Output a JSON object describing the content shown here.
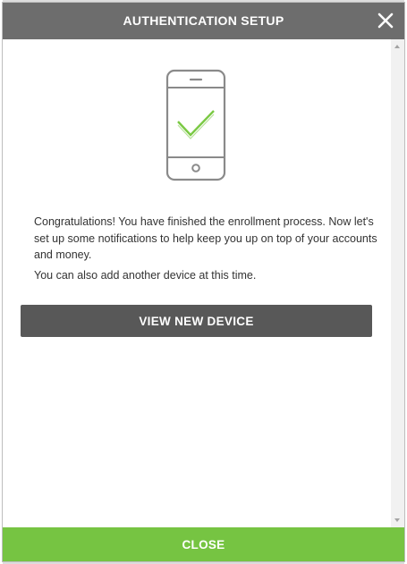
{
  "dialog": {
    "title": "AUTHENTICATION SETUP",
    "close_icon": "close-icon"
  },
  "body": {
    "illustration_icon": "phone-check-icon",
    "paragraph_1": "Congratulations! You have finished the enrollment process. Now let's set up some notifications to help keep you up on top of your accounts and money.",
    "paragraph_2": "You can also add another device at this time.",
    "view_device_label": "VIEW NEW DEVICE"
  },
  "footer": {
    "close_label": "CLOSE"
  },
  "colors": {
    "header_bg": "#6d6d6d",
    "button_bg": "#585858",
    "close_bar_bg": "#76c442",
    "check_green": "#7ac943"
  }
}
